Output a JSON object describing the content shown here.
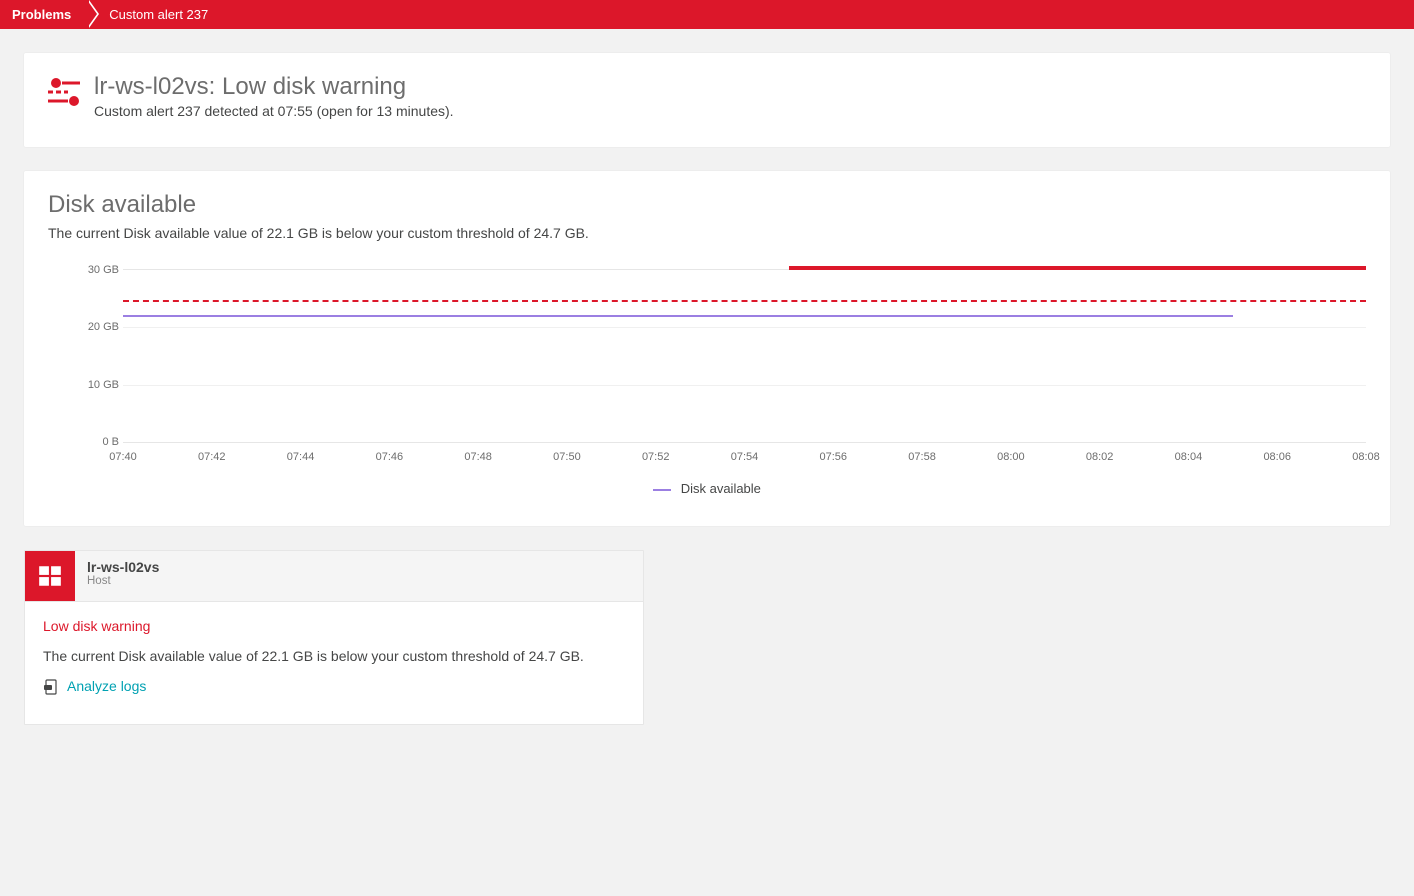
{
  "breadcrumb": {
    "root": "Problems",
    "current": "Custom alert 237"
  },
  "header": {
    "title": "lr-ws-l02vs: Low disk warning",
    "subtitle": "Custom alert 237 detected at 07:55 (open for 13 minutes)."
  },
  "chart": {
    "title": "Disk available",
    "subtitle": "The current Disk available value of 22.1 GB is below your custom threshold of 24.7 GB.",
    "legend_label": "Disk available"
  },
  "chart_data": {
    "type": "line",
    "xlabel": "",
    "ylabel": "",
    "ylim": [
      0,
      30
    ],
    "y_ticks": [
      {
        "v": 30,
        "label": "30 GB"
      },
      {
        "v": 20,
        "label": "20 GB"
      },
      {
        "v": 10,
        "label": "10 GB"
      },
      {
        "v": 0,
        "label": "0 B"
      }
    ],
    "x_ticks": [
      "07:40",
      "07:42",
      "07:44",
      "07:46",
      "07:48",
      "07:50",
      "07:52",
      "07:54",
      "07:56",
      "07:58",
      "08:00",
      "08:02",
      "08:04",
      "08:06",
      "08:08"
    ],
    "x_range_minutes": {
      "start_min": 40,
      "end_min": 68
    },
    "threshold": 24.7,
    "alert_start_min": 55,
    "series": [
      {
        "name": "Disk available",
        "value_constant": 22.1,
        "x_start_min": 40,
        "x_end_min": 65,
        "color": "#9b7fe2"
      }
    ]
  },
  "host": {
    "name": "lr-ws-l02vs",
    "type": "Host",
    "warning_label": "Low disk warning",
    "detail": "The current Disk available value of 22.1 GB is below your custom threshold of 24.7 GB.",
    "analyze_link": "Analyze logs"
  }
}
